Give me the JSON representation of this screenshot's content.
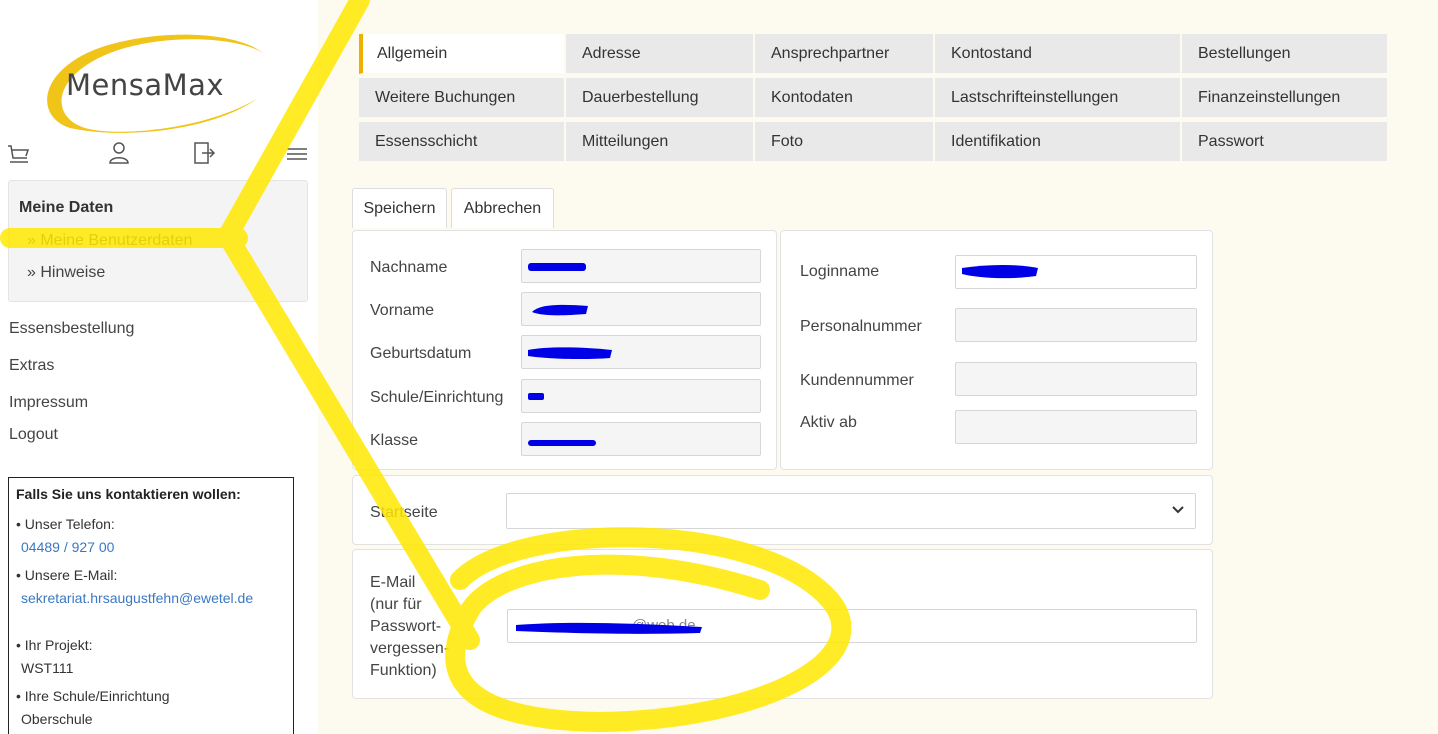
{
  "app": {
    "logo_text": "MensaMax",
    "accent_color": "#f0b000",
    "highlight_color": "#ffe800",
    "redaction_color": "#0000e6"
  },
  "sidebar": {
    "icons": [
      "cart-icon",
      "user-icon",
      "logout-icon",
      "menu-icon"
    ],
    "nav": {
      "title": "Meine Daten",
      "items": [
        {
          "label": "» Meine Benutzerdaten"
        },
        {
          "label": "» Hinweise"
        }
      ]
    },
    "links": [
      {
        "label": "Essensbestellung"
      },
      {
        "label": "Extras"
      },
      {
        "label": "Impressum"
      },
      {
        "label": "Logout"
      }
    ],
    "contact": {
      "title": "Falls Sie uns kontaktieren wollen:",
      "phone_label": "• Unser Telefon:",
      "phone_value": "04489 / 927 00",
      "email_label": "• Unsere E-Mail:",
      "email_value": "sekretariat.hrsaugustfehn@ewetel.de",
      "project_label": "• Ihr Projekt:",
      "project_value": "WST111",
      "school_label": "• Ihre Schule/Einrichtung",
      "school_value": "Oberschule"
    }
  },
  "tabs": {
    "row1": [
      "Allgemein",
      "Adresse",
      "Ansprechpartner",
      "Kontostand",
      "Bestellungen"
    ],
    "row2": [
      "Weitere Buchungen",
      "Dauerbestellung",
      "Kontodaten",
      "Lastschrifteinstellungen",
      "Finanzeinstellungen"
    ],
    "row3": [
      "Essensschicht",
      "Mitteilungen",
      "Foto",
      "Identifikation",
      "Passwort"
    ],
    "active": "Allgemein"
  },
  "form": {
    "save_label": "Speichern",
    "cancel_label": "Abbrechen",
    "left": {
      "nachname_label": "Nachname",
      "vorname_label": "Vorname",
      "geburtsdatum_label": "Geburtsdatum",
      "schule_label": "Schule/Einrichtung",
      "klasse_label": "Klasse"
    },
    "right": {
      "loginname_label": "Loginname",
      "personalnummer_label": "Personalnummer",
      "kundennummer_label": "Kundennummer",
      "aktiv_ab_label": "Aktiv ab"
    },
    "startseite_label": "Startseite",
    "email_label_lines": [
      "E-Mail",
      "(nur für",
      "Passwort-",
      "vergessen-",
      "Funktion)"
    ],
    "email_value_visible": "@web.de"
  }
}
